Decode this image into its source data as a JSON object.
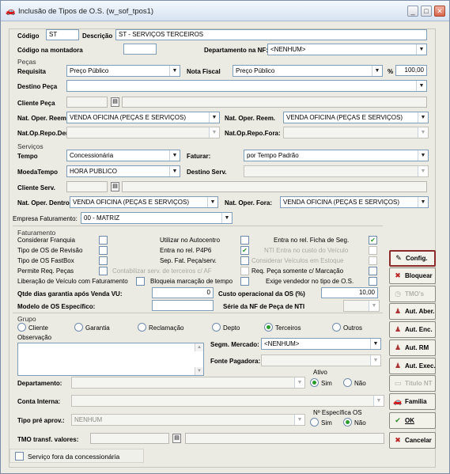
{
  "window": {
    "title": "Inclusão de Tipos de O.S. (w_sof_tpos1)"
  },
  "top": {
    "codigo_label": "Código",
    "codigo_value": "ST",
    "descricao_label": "Descrição",
    "descricao_value": "ST - SERVIÇOS TERCEIROS",
    "codigo_montadora_label": "Código na montadora",
    "codigo_montadora_value": "",
    "departamento_nf_label": "Departamento na NF:",
    "departamento_nf_value": "<NENHUM>"
  },
  "pecas": {
    "section": "Peças",
    "requisita_label": "Requisita",
    "requisita_value": "Preço Público",
    "nota_fiscal_label": "Nota Fiscal",
    "nota_fiscal_value": "Preço Público",
    "percent_label": "%",
    "percent_value": "100,00",
    "destino_label": "Destino Peça",
    "destino_value": "",
    "cliente_label": "Cliente Peça",
    "nat_reem_label": "Nat. Oper. Reem.",
    "nat_reem_value": "VENDA OFICINA (PEÇAS E SERVIÇOS)",
    "nat_reem2_label": "Nat. Oper. Reem.",
    "nat_reem2_value": "VENDA OFICINA (PEÇAS E SERVIÇOS)",
    "nat_repo_den_label": "Nat.Op.Repo.Den:",
    "nat_repo_fora_label": "Nat.Op.Repo.Fora:"
  },
  "servicos": {
    "section": "Serviços",
    "tempo_label": "Tempo",
    "tempo_value": "Concessionária",
    "faturar_label": "Faturar:",
    "faturar_value": "por Tempo Padrão",
    "moeda_label": "MoedaTempo",
    "moeda_value": "HORA PUBLICO",
    "destino_label": "Destino Serv.",
    "cliente_label": "Cliente Serv.",
    "nat_dentro_label": "Nat. Oper. Dentro:",
    "nat_dentro_value": "VENDA OFICINA (PEÇAS E SERVIÇOS)",
    "nat_fora_label": "Nat. Oper. Fora:",
    "nat_fora_value": "VENDA OFICINA (PEÇAS E SERVIÇOS)",
    "empresa_label": "Empresa Faturamento:",
    "empresa_value": "00 - MATRIZ"
  },
  "faturamento": {
    "section": "Faturamento",
    "c1": [
      "Considerar Franquia",
      "Tipo de OS de Revisão",
      "Tipo de OS FastBox",
      "Permite Req. Peças"
    ],
    "c2": [
      "Utilizar no Autocentro",
      "Entra no rel. P4P6",
      "Sep. Fat. Peça/serv.",
      "Contabilizar serv. de terceiros c/ AF"
    ],
    "c3": [
      "Entra no rel. Ficha de Seg.",
      "NTI Entra no custo do Veículo",
      "Considerar Veículos em Estoque",
      "Req. Peça somente c/ Marcação"
    ],
    "liberacao_label": "Liberação de Veículo com Faturamento",
    "bloqueia_label": "Bloqueia marcação de tempo",
    "exige_label": "Exige vendedor no tipo de O.S.",
    "qtde_label": "Qtde dias garantia após Venda VU:",
    "qtde_value": "0",
    "custo_label": "Custo operacional da OS (%)",
    "custo_value": "10,00",
    "modelo_label": "Modelo de OS Específico:",
    "serie_label": "Série da NF de Peça de NTI"
  },
  "grupo": {
    "section": "Grupo",
    "options": [
      "Cliente",
      "Garantia",
      "Reclamação",
      "Depto",
      "Terceiros",
      "Outros"
    ],
    "selected": "Terceiros",
    "observacao_label": "Observação",
    "segm_label": "Segm. Mercado:",
    "segm_value": "<NENHUM>",
    "fonte_label": "Fonte Pagadora:"
  },
  "bottom": {
    "departamento_label": "Departamento:",
    "conta_label": "Conta Interna:",
    "tipo_pre_label": "Tipo pré aprov.:",
    "tipo_pre_value": "NENHUM",
    "ativo_label": "Ativo",
    "ativo_sim": "Sim",
    "ativo_nao": "Não",
    "especifica_label": "Nº Específica OS",
    "esp_sim": "Sim",
    "esp_nao": "Não",
    "tmo_label": "TMO transf. valores:",
    "servico_fora_label": "Serviço fora da concessionária"
  },
  "buttons": [
    {
      "label": "Config.",
      "icon": "gear-icon"
    },
    {
      "label": "Bloquear",
      "icon": "block-icon"
    },
    {
      "label": "TMO's",
      "icon": "clock-icon"
    },
    {
      "label": "Aut. Aber.",
      "icon": "person-icon"
    },
    {
      "label": "Aut. Enc.",
      "icon": "person-icon"
    },
    {
      "label": "Aut. RM",
      "icon": "person-icon"
    },
    {
      "label": "Aut. Exec.",
      "icon": "person-icon"
    },
    {
      "label": "Titulo NT",
      "icon": "doc-icon"
    },
    {
      "label": "Familia",
      "icon": "car-icon"
    },
    {
      "label": "OK",
      "icon": "check-icon"
    },
    {
      "label": "Cancelar",
      "icon": "cancel-icon"
    }
  ]
}
